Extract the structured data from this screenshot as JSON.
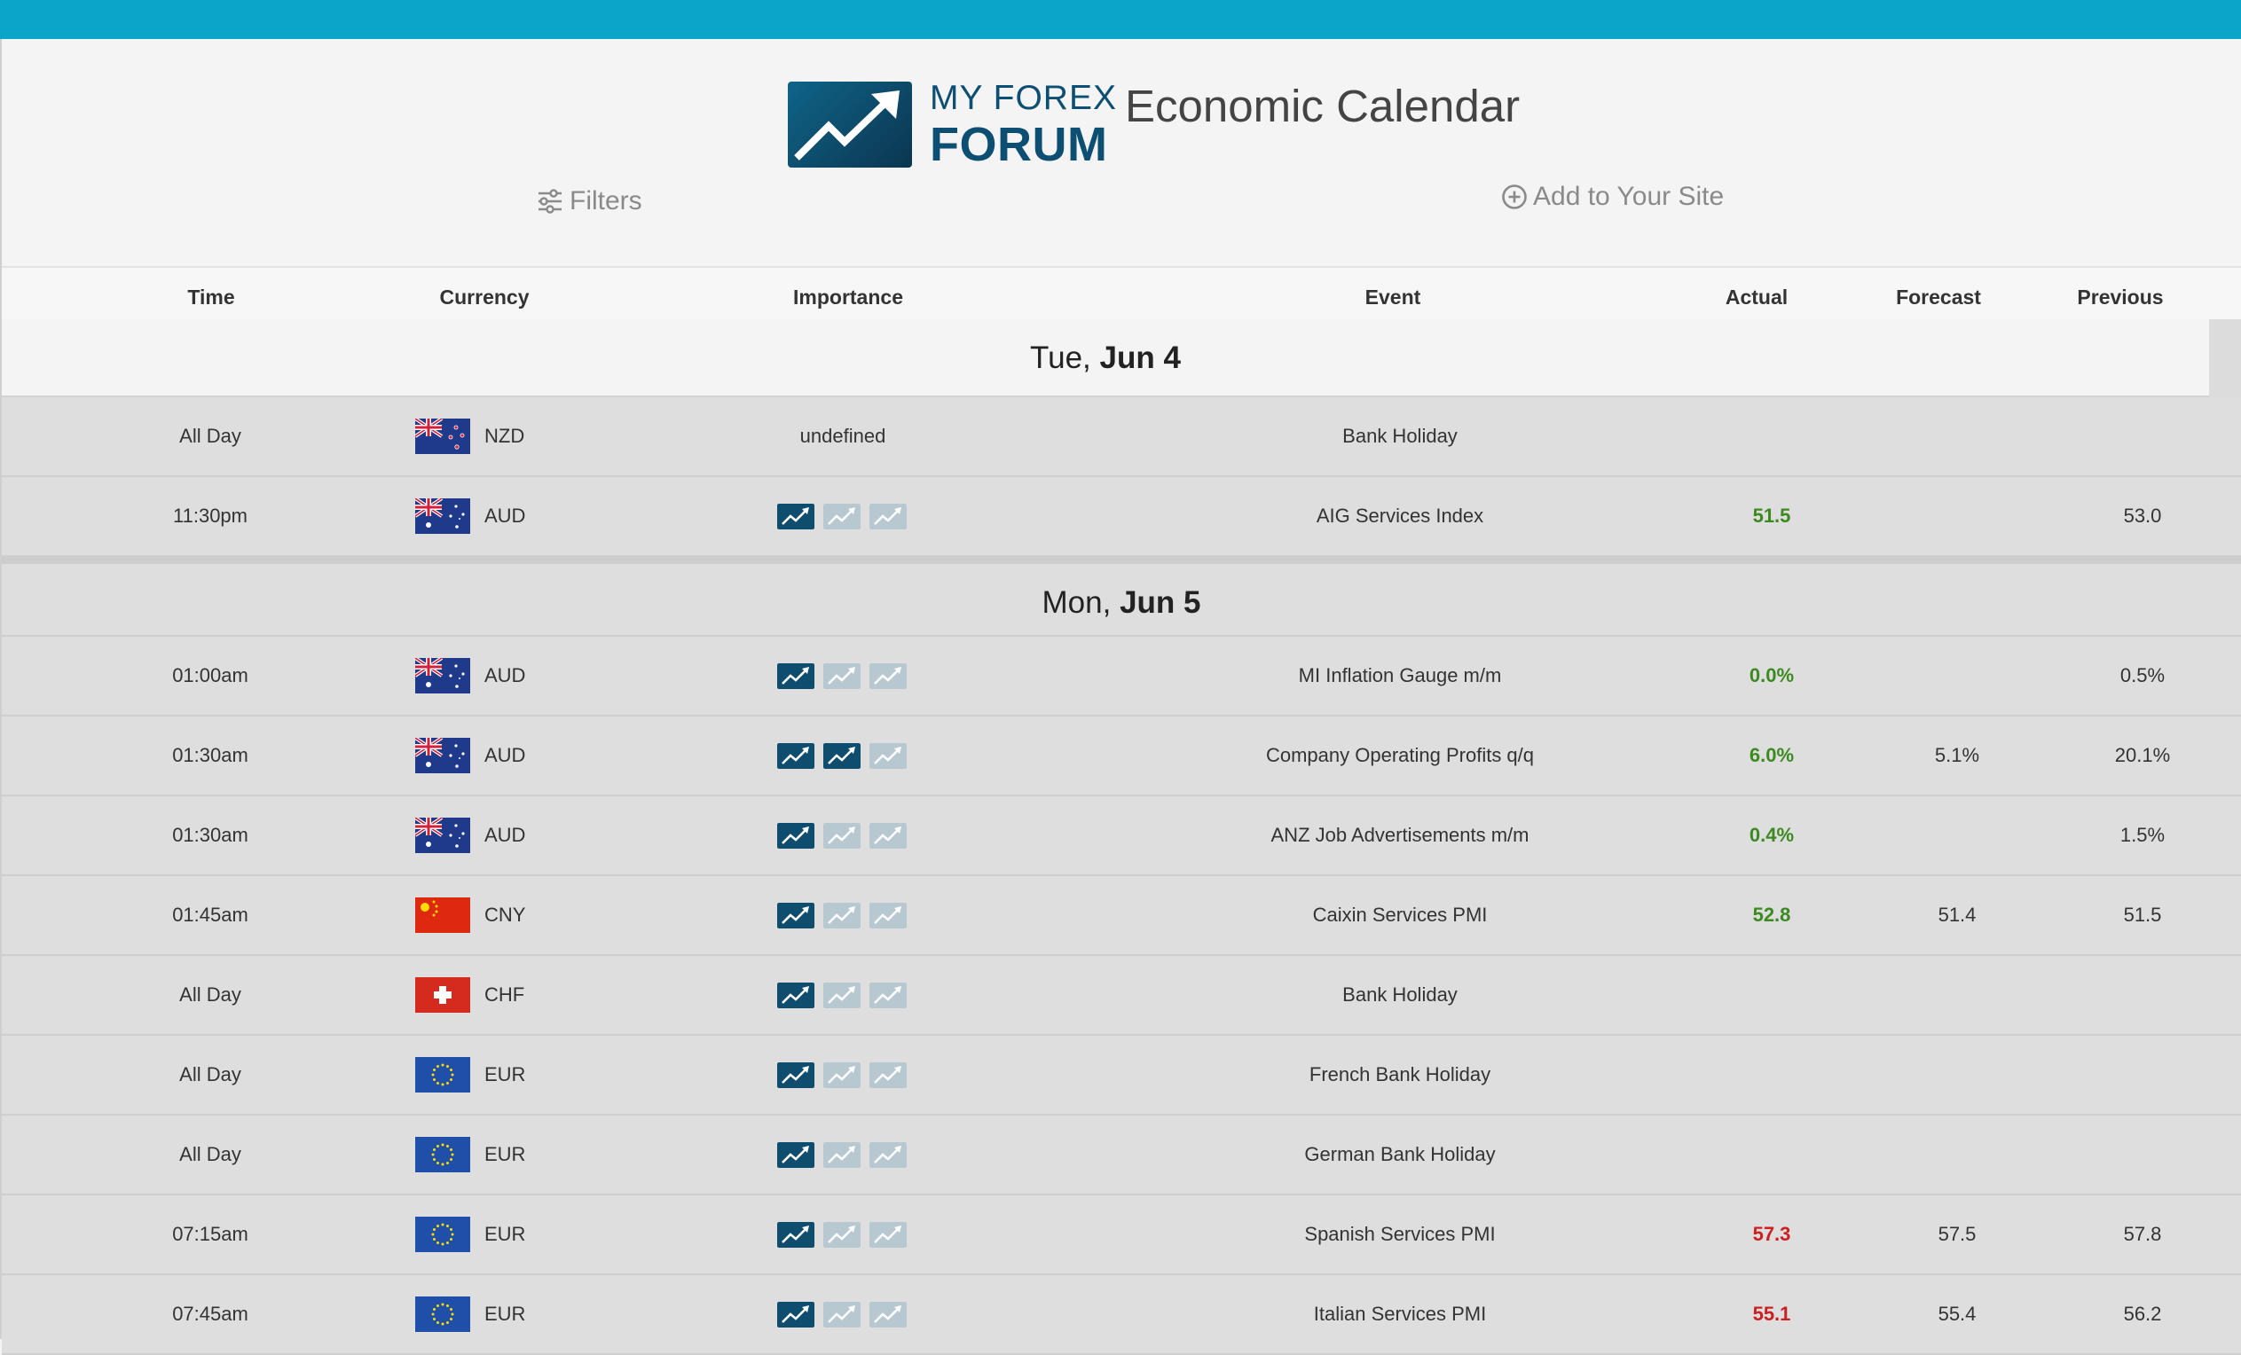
{
  "brand": {
    "logo_line1": "MY FOREX",
    "logo_line2": "FORUM",
    "title": "Economic Calendar",
    "color": "#0d4f72",
    "topbar_color": "#0aa5c8"
  },
  "toolbar": {
    "filters_label": "Filters",
    "add_site_label": "Add to Your Site",
    "filters_icon": "sliders-icon",
    "add_icon": "plus-circle-icon"
  },
  "table": {
    "headers": {
      "time": "Time",
      "currency": "Currency",
      "importance": "Importance",
      "event": "Event",
      "actual": "Actual",
      "forecast": "Forecast",
      "previous": "Previous"
    },
    "colors": {
      "positive": "#3b8a1f",
      "negative": "#cc1f1f",
      "impact_on": "#0e4d6e",
      "impact_off": "#b8c8d0"
    },
    "days": [
      {
        "weekday": "Tue,",
        "date": "Jun 4",
        "rows": [
          {
            "time": "All Day",
            "flag": "nz",
            "currency": "NZD",
            "importance": "undefined",
            "event": "Bank Holiday",
            "actual": "",
            "actual_dir": "",
            "forecast": "",
            "previous": ""
          },
          {
            "time": "11:30pm",
            "flag": "au",
            "currency": "AUD",
            "importance": 1,
            "event": "AIG Services Index",
            "actual": "51.5",
            "actual_dir": "positive",
            "forecast": "",
            "previous": "53.0"
          }
        ]
      },
      {
        "weekday": "Mon,",
        "date": "Jun 5",
        "rows": [
          {
            "time": "01:00am",
            "flag": "au",
            "currency": "AUD",
            "importance": 1,
            "event": "MI Inflation Gauge m/m",
            "actual": "0.0%",
            "actual_dir": "positive",
            "forecast": "",
            "previous": "0.5%"
          },
          {
            "time": "01:30am",
            "flag": "au",
            "currency": "AUD",
            "importance": 2,
            "event": "Company Operating Profits q/q",
            "actual": "6.0%",
            "actual_dir": "positive",
            "forecast": "5.1%",
            "previous": "20.1%"
          },
          {
            "time": "01:30am",
            "flag": "au",
            "currency": "AUD",
            "importance": 1,
            "event": "ANZ Job Advertisements m/m",
            "actual": "0.4%",
            "actual_dir": "positive",
            "forecast": "",
            "previous": "1.5%"
          },
          {
            "time": "01:45am",
            "flag": "cn",
            "currency": "CNY",
            "importance": 1,
            "event": "Caixin Services PMI",
            "actual": "52.8",
            "actual_dir": "positive",
            "forecast": "51.4",
            "previous": "51.5"
          },
          {
            "time": "All Day",
            "flag": "ch",
            "currency": "CHF",
            "importance": 1,
            "event": "Bank Holiday",
            "actual": "",
            "actual_dir": "",
            "forecast": "",
            "previous": ""
          },
          {
            "time": "All Day",
            "flag": "eu",
            "currency": "EUR",
            "importance": 1,
            "event": "French Bank Holiday",
            "actual": "",
            "actual_dir": "",
            "forecast": "",
            "previous": ""
          },
          {
            "time": "All Day",
            "flag": "eu",
            "currency": "EUR",
            "importance": 1,
            "event": "German Bank Holiday",
            "actual": "",
            "actual_dir": "",
            "forecast": "",
            "previous": ""
          },
          {
            "time": "07:15am",
            "flag": "eu",
            "currency": "EUR",
            "importance": 1,
            "event": "Spanish Services PMI",
            "actual": "57.3",
            "actual_dir": "negative",
            "forecast": "57.5",
            "previous": "57.8"
          },
          {
            "time": "07:45am",
            "flag": "eu",
            "currency": "EUR",
            "importance": 1,
            "event": "Italian Services PMI",
            "actual": "55.1",
            "actual_dir": "negative",
            "forecast": "55.4",
            "previous": "56.2"
          }
        ]
      }
    ]
  }
}
